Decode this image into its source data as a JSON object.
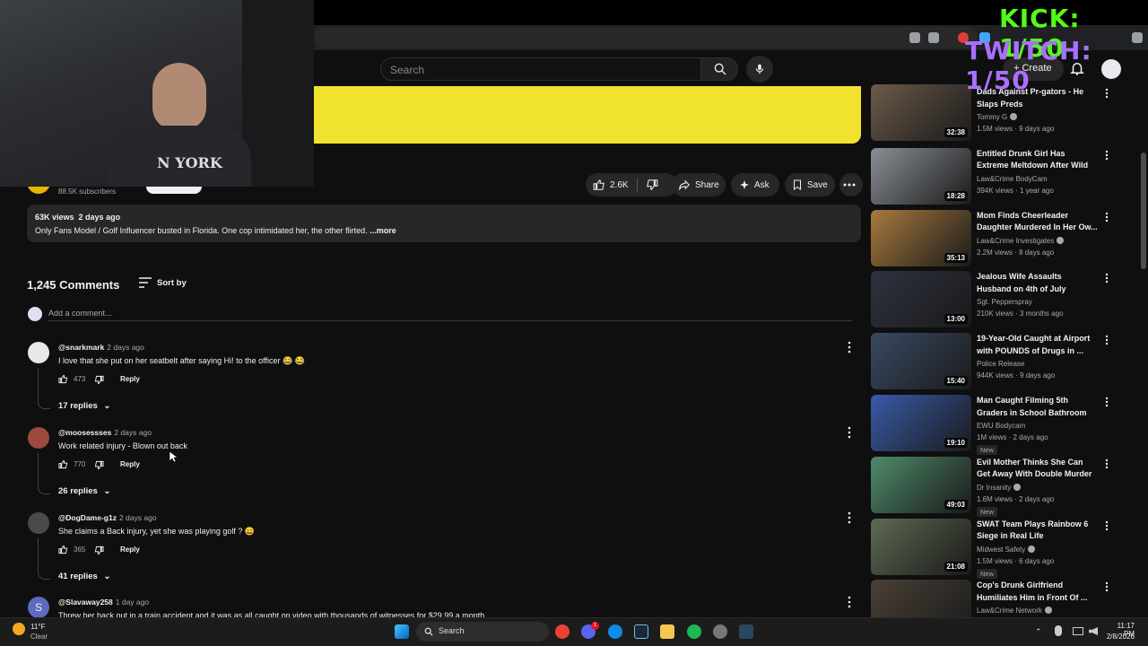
{
  "overlay": {
    "kick": "KICK: 1/50",
    "twitch": "TWITCH: 1/50",
    "kick_color": "#53fc18",
    "twitch_color": "#a970ff"
  },
  "header": {
    "search_placeholder": "Search",
    "create_label": "Create"
  },
  "channel": {
    "subscribers": "88.5K subscribers"
  },
  "actions": {
    "likes": "2.6K",
    "share": "Share",
    "ask": "Ask",
    "save": "Save"
  },
  "description": {
    "views": "63K views",
    "date": "2 days ago",
    "text": "Only Fans Model / Golf Influencer busted in Florida. One cop intimidated her, the other flirted.",
    "more": "...more"
  },
  "comments": {
    "count": "1,245 Comments",
    "sort": "Sort by",
    "add_placeholder": "Add a comment...",
    "reply_label": "Reply",
    "items": [
      {
        "author": "@snarkmark",
        "time": "2 days ago",
        "text": "I love that she put on her seatbelt after saying Hi! to the officer 😂 😂",
        "likes": "473",
        "replies": "17 replies"
      },
      {
        "author": "@moosessses",
        "time": "2 days ago",
        "text": "Work related injury - Blown out back",
        "likes": "770",
        "replies": "26 replies"
      },
      {
        "author": "@DogDame-g1z",
        "time": "2 days ago",
        "text": "She claims a Back injury, yet she was playing golf ? 😄",
        "likes": "365",
        "replies": "41 replies"
      },
      {
        "author": "@Slavaway258",
        "time": "1 day ago",
        "text": "Threw her back out in a train accident and it was as all caught on video with thousands of witnesses for $29.99 a month",
        "avatar_letter": "S"
      }
    ]
  },
  "recommended": [
    {
      "title": "Dads Against Pr-gators - He Slaps Preds",
      "channel": "Tommy G",
      "meta": "1.5M views · 9 days ago",
      "duration": "32:38",
      "verified": true,
      "new": false
    },
    {
      "title": "Entitled Drunk Girl Has Extreme Meltdown After Wild Night",
      "channel": "Law&Crime BodyCam",
      "meta": "394K views · 1 year ago",
      "duration": "18:28",
      "verified": false,
      "new": false
    },
    {
      "title": "Mom Finds Cheerleader Daughter Murdered In Her Ow...",
      "channel": "Law&Crime Investigates",
      "meta": "2.2M views · 8 days ago",
      "duration": "35:13",
      "verified": true,
      "new": false
    },
    {
      "title": "Jealous Wife Assaults Husband on 4th of July",
      "channel": "Sgt. Pepperspray",
      "meta": "210K views · 3 months ago",
      "duration": "13:00",
      "verified": false,
      "new": false
    },
    {
      "title": "19-Year-Old Caught at Airport with POUNDS of Drugs in ...",
      "channel": "Police Release",
      "meta": "944K views · 9 days ago",
      "duration": "15:40",
      "verified": false,
      "new": false
    },
    {
      "title": "Man Caught Filming 5th Graders in School Bathroom",
      "channel": "EWU Bodycam",
      "meta": "1M views · 2 days ago",
      "duration": "19:10",
      "verified": false,
      "new": true
    },
    {
      "title": "Evil Mother Thinks She Can Get Away With Double Murder",
      "channel": "Dr Insanity",
      "meta": "1.6M views · 2 days ago",
      "duration": "49:03",
      "verified": true,
      "new": true
    },
    {
      "title": "SWAT Team Plays Rainbow 6 Siege in Real Life",
      "channel": "Midwest Safety",
      "meta": "1.5M views · 6 days ago",
      "duration": "21:08",
      "verified": true,
      "new": true
    },
    {
      "title": "Cop's Drunk Girlfriend Humiliates Him in Front Of ...",
      "channel": "Law&Crime Network",
      "meta": "",
      "duration": "",
      "verified": true,
      "new": false
    }
  ],
  "taskbar": {
    "weather_temp": "11°F",
    "weather_desc": "Clear",
    "search": "Search",
    "time": "11:17 PM",
    "date": "2/8/2026",
    "discord_badge": "1"
  }
}
